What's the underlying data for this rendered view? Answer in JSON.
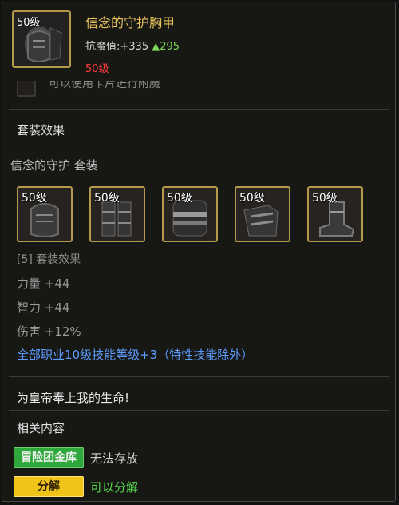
{
  "item": {
    "level_badge": "50级",
    "name": "信念的守护胸甲",
    "stat_label": "抗魔值",
    "stat_value": ":+335",
    "stat_bonus": "▲295",
    "required_level": "50级",
    "enchant_text": "可以使用卡片进行附魔"
  },
  "set_section": {
    "title": "套装效果",
    "set_name": "信念的守护  套装",
    "pieces": [
      {
        "level": "50级",
        "icon": "chest-armor-icon"
      },
      {
        "level": "50级",
        "icon": "leg-armor-icon"
      },
      {
        "level": "50级",
        "icon": "shoulder-armor-icon"
      },
      {
        "level": "50级",
        "icon": "belt-armor-icon"
      },
      {
        "level": "50级",
        "icon": "boots-armor-icon"
      }
    ],
    "bonus_title": "[5] 套装效果",
    "bonuses": [
      "力量 +44",
      "智力 +44",
      "伤害 +12%"
    ],
    "skill_bonus": "全部职业10级技能等级+3（特性技能除外）"
  },
  "flavor_text": "为皇帝奉上我的生命!",
  "related": {
    "title": "相关内容",
    "guild_badge": "冒险团金库",
    "guild_desc": "无法存放",
    "split_badge": "分解",
    "split_desc": "可以分解"
  },
  "colors": {
    "item_name": "#e6c15a",
    "stat_green": "#7ed957",
    "required_level_red": "#ff3b3b",
    "skill_blue": "#5c9cff",
    "guild_badge_green": "#2ea83a",
    "split_badge_yellow": "#f0c419"
  }
}
